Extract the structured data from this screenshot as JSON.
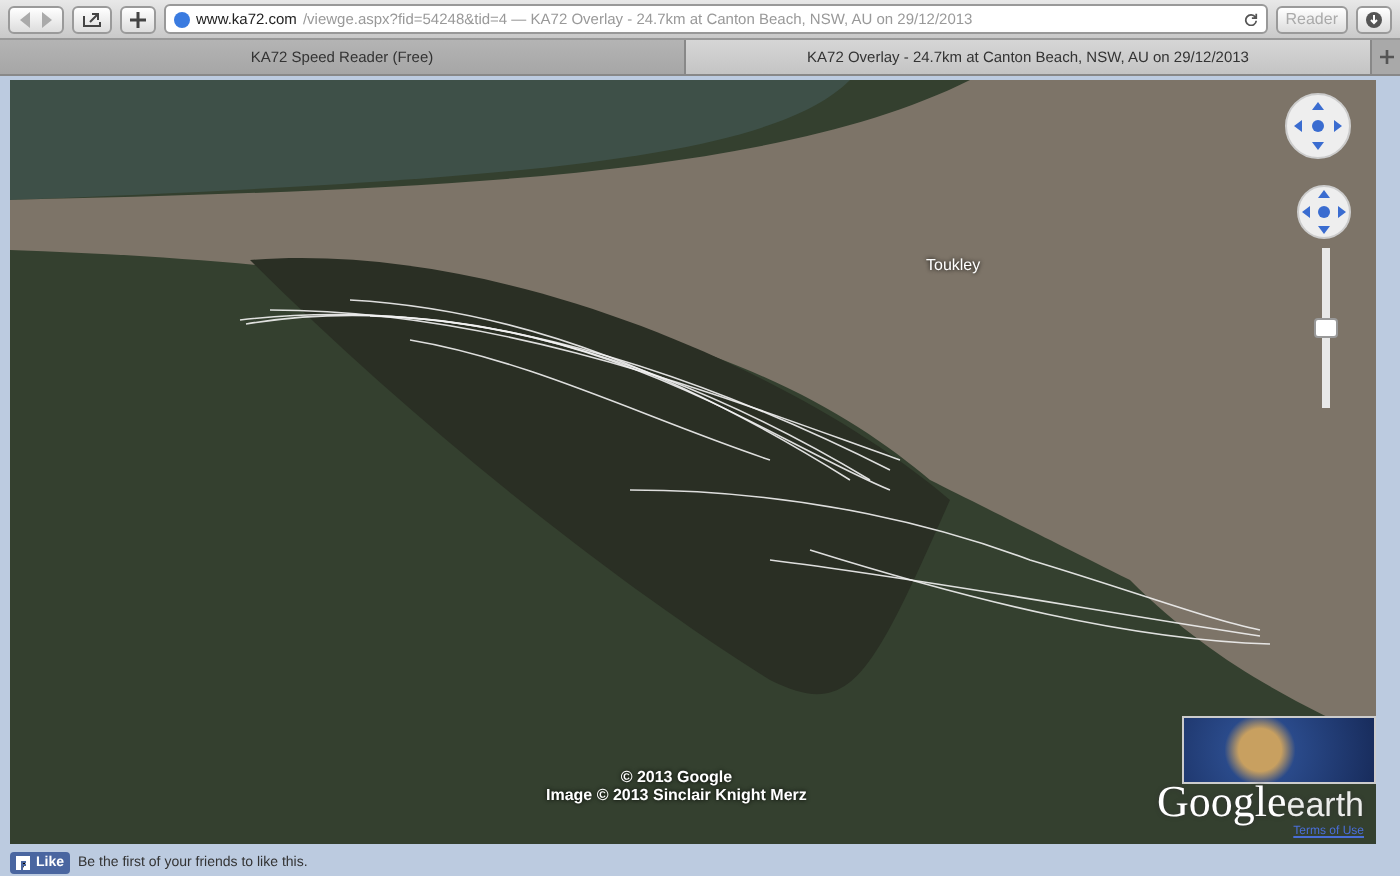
{
  "toolbar": {
    "url_host": "www.ka72.com",
    "url_rest": "/viewge.aspx?fid=54248&tid=4 — KA72 Overlay - 24.7km at Canton Beach, NSW, AU on 29/12/2013",
    "reader": "Reader"
  },
  "tabs": [
    {
      "label": "KA72 Speed Reader (Free)",
      "selected": false
    },
    {
      "label": "KA72 Overlay - 24.7km at Canton Beach, NSW, AU on 29/12/2013",
      "selected": true
    }
  ],
  "map": {
    "place_label": "Toukley",
    "zoom": {
      "level": 0.5
    },
    "credits": [
      "© 2013 Google",
      "Image © 2013 Sinclair Knight Merz"
    ],
    "logo_main": "Google",
    "logo_sub": "earth",
    "terms": "Terms of Use"
  },
  "like": {
    "button": "Like",
    "text": "Be the first of your friends to like this."
  }
}
